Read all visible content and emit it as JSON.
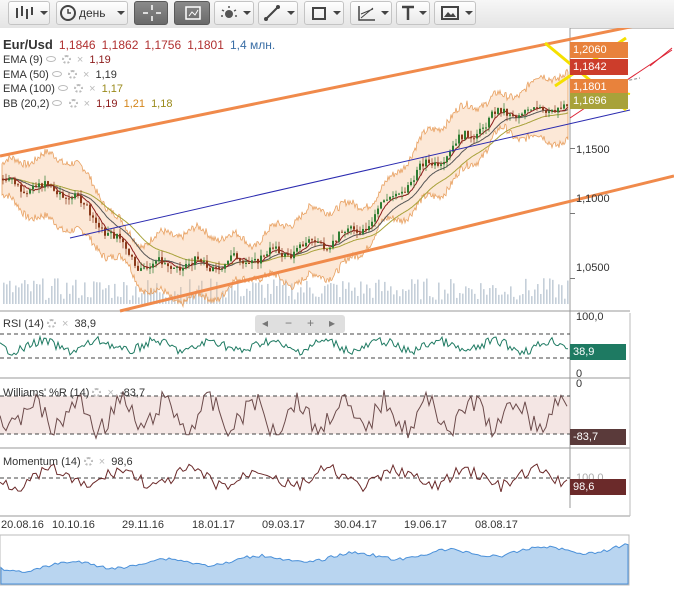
{
  "toolbar": {
    "period_label": "день",
    "icons": [
      "bar-type-icon",
      "clock-icon",
      "crosshair-icon",
      "indicator-icon",
      "settings-icon",
      "line-tool-icon",
      "shape-tool-icon",
      "fib-tool-icon",
      "text-tool-icon",
      "image-tool-icon"
    ]
  },
  "main": {
    "symbol": "Eur/Usd",
    "ohlc": [
      "1,1846",
      "1,1862",
      "1,1756",
      "1,1801"
    ],
    "volume": "1,4 млн.",
    "indicators": [
      {
        "name": "EMA (9)",
        "value": "1,19",
        "color": "#8b1a1a"
      },
      {
        "name": "EMA (50)",
        "value": "1,19",
        "color": "#333333"
      },
      {
        "name": "EMA (100)",
        "value": "1,17",
        "color": "#9a8a1a"
      },
      {
        "name": "BB (20,2)",
        "values": [
          "1,19",
          "1,21",
          "1,18"
        ],
        "colors": [
          "#8b1a1a",
          "#d4851a",
          "#9a8a1a"
        ]
      }
    ]
  },
  "price_axis": {
    "ticks": [
      "1,1500",
      "1,1000",
      "1,0500"
    ],
    "badges": [
      {
        "label": "1,2060",
        "color": "#e8823c"
      },
      {
        "label": "1,1842",
        "color": "#cc3d2b"
      },
      {
        "label": "1,1801",
        "color": "#e8823c"
      },
      {
        "label": "1,1696",
        "color": "#a8a23a"
      }
    ]
  },
  "rsi": {
    "label": "RSI (14)",
    "value": "38,9",
    "scale_top": "100,0",
    "scale_bottom": "0",
    "color": "#1e7a62"
  },
  "williams": {
    "label": "Williams' %R (14)",
    "value": "-83,7",
    "scale_top": "0",
    "color": "#5a3a3a"
  },
  "momentum": {
    "label": "Momentum (14)",
    "value": "98,6",
    "scale_mid": "100,0",
    "color": "#6b2a2a"
  },
  "x_axis": {
    "labels": [
      "20.08.16",
      "10.10.16",
      "29.11.16",
      "18.01.17",
      "09.03.17",
      "30.04.17",
      "19.06.17",
      "08.08.17"
    ]
  },
  "navbar_buttons": [
    "◂",
    "−",
    "+",
    "▸"
  ],
  "chart_data": {
    "type": "line",
    "price": {
      "x": [
        "20.08.16",
        "10.10.16",
        "29.11.16",
        "18.01.17",
        "09.03.17",
        "30.04.17",
        "19.06.17",
        "08.08.17",
        "2017-09"
      ],
      "y": [
        1.125,
        1.115,
        1.06,
        1.06,
        1.07,
        1.085,
        1.135,
        1.175,
        1.183
      ]
    },
    "y_ticks": [
      1.15,
      1.1,
      1.05
    ],
    "rsi_last": 38.9,
    "williams_last": -83.7,
    "momentum_last": 98.6
  }
}
